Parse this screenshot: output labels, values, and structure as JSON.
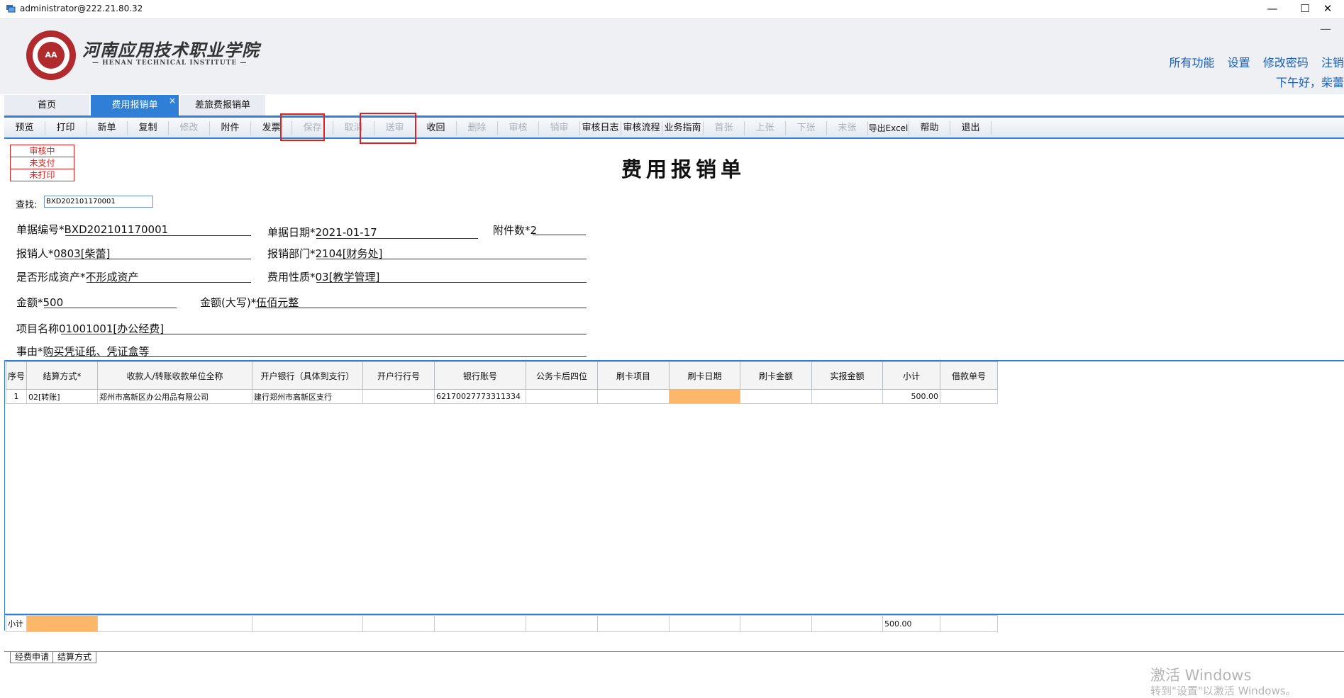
{
  "window": {
    "title": "administrator@222.21.80.32"
  },
  "header": {
    "logo_cn": "河南应用技术职业学院",
    "logo_en": "— HENAN TECHNICAL INSTITUTE —",
    "links": [
      "所有功能",
      "设置",
      "修改密码",
      "注销"
    ],
    "greeting": "下午好，柴蕾"
  },
  "tabs": [
    {
      "label": "首页"
    },
    {
      "label": "费用报销单",
      "active": true
    },
    {
      "label": "差旅费报销单"
    }
  ],
  "toolbar": [
    {
      "label": "预览",
      "enabled": true
    },
    {
      "label": "打印",
      "enabled": true
    },
    {
      "label": "新单",
      "enabled": true
    },
    {
      "label": "复制",
      "enabled": true
    },
    {
      "label": "修改",
      "enabled": false
    },
    {
      "label": "附件",
      "enabled": true
    },
    {
      "label": "发票",
      "enabled": true
    },
    {
      "label": "保存",
      "enabled": false,
      "highlighted": true
    },
    {
      "label": "取消",
      "enabled": false
    },
    {
      "label": "送审",
      "enabled": false,
      "highlighted": true
    },
    {
      "label": "收回",
      "enabled": true
    },
    {
      "label": "删除",
      "enabled": false
    },
    {
      "label": "审核",
      "enabled": false
    },
    {
      "label": "销审",
      "enabled": false
    },
    {
      "label": "审核日志",
      "enabled": true
    },
    {
      "label": "审核流程",
      "enabled": true
    },
    {
      "label": "业务指南",
      "enabled": true
    },
    {
      "label": "首张",
      "enabled": false
    },
    {
      "label": "上张",
      "enabled": false
    },
    {
      "label": "下张",
      "enabled": false
    },
    {
      "label": "末张",
      "enabled": false
    },
    {
      "label": "导出Excel",
      "enabled": true
    },
    {
      "label": "帮助",
      "enabled": true
    },
    {
      "label": "退出",
      "enabled": true
    }
  ],
  "status": [
    "审核中",
    "未支付",
    "未打印"
  ],
  "doc_title": "费用报销单",
  "search": {
    "label": "查找:",
    "value": "BXD202101170001"
  },
  "form": {
    "doc_no": {
      "label": "单据编号*",
      "value": "BXD202101170001"
    },
    "doc_date": {
      "label": "单据日期*",
      "value": "2021-01-17"
    },
    "attachments": {
      "label": "附件数*",
      "value": "2"
    },
    "claimant": {
      "label": "报销人*",
      "value": "0803[柴蕾]"
    },
    "department": {
      "label": "报销部门*",
      "value": "2104[财务处]"
    },
    "asset": {
      "label": "是否形成资产*",
      "value": "不形成资产"
    },
    "expense_type": {
      "label": "费用性质*",
      "value": "03[教学管理]"
    },
    "amount": {
      "label": "金额*",
      "value": "500"
    },
    "amount_cn": {
      "label": "金额(大写)*",
      "value": "伍佰元整"
    },
    "project": {
      "label": "项目名称",
      "value": "01001001[办公经费]"
    },
    "reason": {
      "label": "事由*",
      "value": "购买凭证纸、凭证盒等"
    }
  },
  "grid": {
    "columns": [
      "序号",
      "结算方式*",
      "收款人/转账收款单位全称",
      "开户银行（具体到支行）",
      "开户行行号",
      "银行账号",
      "公务卡后四位",
      "刷卡项目",
      "刷卡日期",
      "刷卡金额",
      "实报金额",
      "小计",
      "借款单号"
    ],
    "rows": [
      [
        "1",
        "02[转账]",
        "郑州市高新区办公用品有限公司",
        "建行郑州市高新区支行",
        "",
        "62170027773311334",
        "",
        "",
        "",
        "",
        "",
        "500.00",
        ""
      ]
    ],
    "subtotal_label": "小计",
    "subtotal_value": "500.00"
  },
  "sheet_tabs": [
    "经费申请",
    "结算方式"
  ],
  "watermark": {
    "line1": "激活 Windows",
    "line2": "转到\"设置\"以激活 Windows。"
  },
  "colors": {
    "accent": "#2f7fd6",
    "highlight": "#e32020",
    "cell_highlight": "#fcb868",
    "link": "#1a5fb4"
  }
}
